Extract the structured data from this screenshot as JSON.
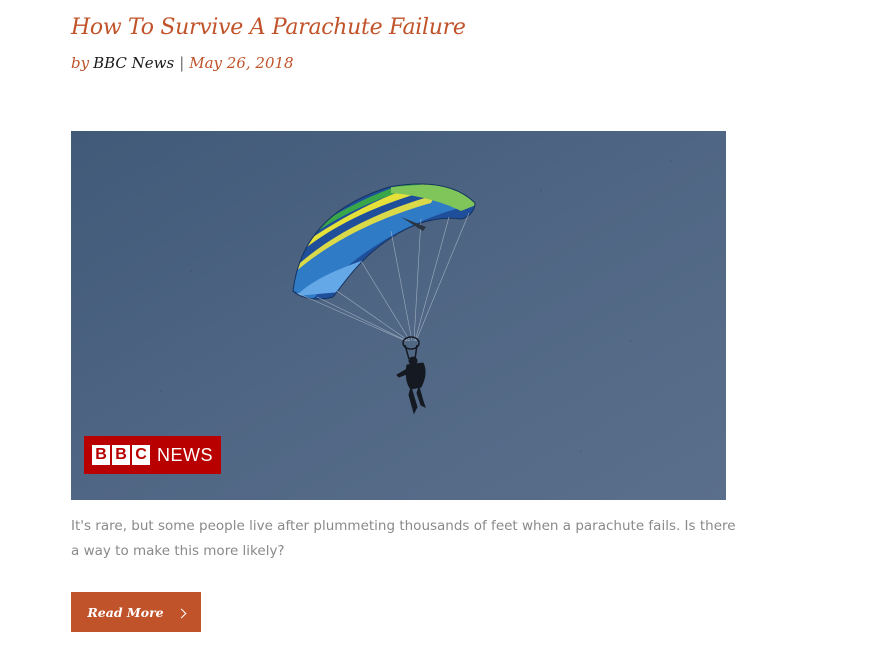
{
  "post": {
    "title": "How To Survive A Parachute Failure",
    "meta": {
      "by_label": "by",
      "author": "BBC News",
      "separator": "|",
      "date": "May 26, 2018"
    },
    "image": {
      "alt": "Parachutist descending under a blue and yellow canopy",
      "badge": {
        "letters": [
          "B",
          "B",
          "C"
        ],
        "word": "NEWS"
      }
    },
    "excerpt": "It's rare, but some people live after plummeting thousands of feet when a parachute fails. Is there a way to make this more likely?",
    "read_more_label": "Read More"
  },
  "colors": {
    "accent": "#c0532a",
    "excerpt_text": "#8a8a8a",
    "bbc_red": "#b80000",
    "sky": "#4d6482"
  },
  "icons": {
    "read_more": "chevron-right-icon"
  }
}
